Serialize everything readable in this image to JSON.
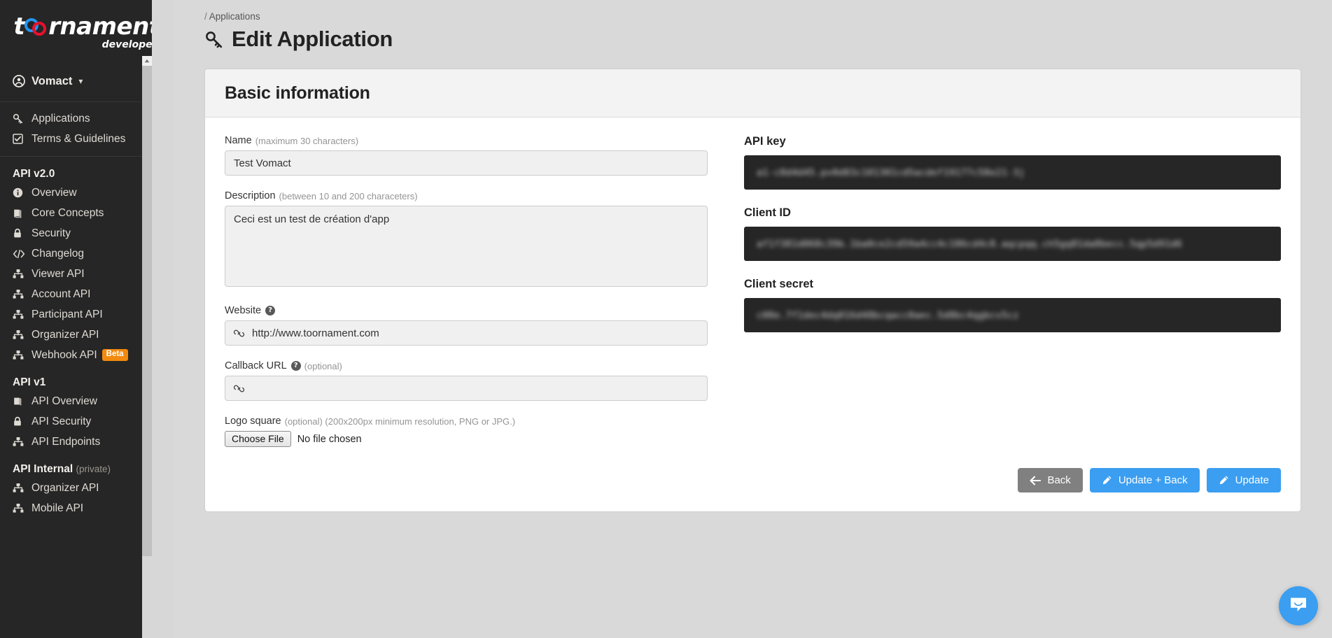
{
  "sidebar": {
    "logo": {
      "text_main": "t",
      "text_rest": "rnament",
      "subtitle": "developer"
    },
    "user": {
      "name": "Vomact",
      "avatar_icon": "user-circle-icon",
      "chevron_icon": "chevron-down-icon"
    },
    "primary_items": [
      {
        "label": "Applications",
        "icon": "key-icon"
      },
      {
        "label": "Terms & Guidelines",
        "icon": "checkbox-checked-icon"
      }
    ],
    "groups": [
      {
        "heading": "API v2.0",
        "heading_note": "",
        "items": [
          {
            "label": "Overview",
            "icon": "info-circle-icon"
          },
          {
            "label": "Core Concepts",
            "icon": "book-icon"
          },
          {
            "label": "Security",
            "icon": "lock-icon"
          },
          {
            "label": "Changelog",
            "icon": "code-icon"
          },
          {
            "label": "Viewer API",
            "icon": "sitemap-icon"
          },
          {
            "label": "Account API",
            "icon": "sitemap-icon"
          },
          {
            "label": "Participant API",
            "icon": "sitemap-icon"
          },
          {
            "label": "Organizer API",
            "icon": "sitemap-icon"
          },
          {
            "label": "Webhook API",
            "icon": "sitemap-icon",
            "badge": "Beta"
          }
        ]
      },
      {
        "heading": "API v1",
        "heading_note": "",
        "items": [
          {
            "label": "API Overview",
            "icon": "book-icon"
          },
          {
            "label": "API Security",
            "icon": "lock-icon"
          },
          {
            "label": "API Endpoints",
            "icon": "sitemap-icon"
          }
        ]
      },
      {
        "heading": "API Internal",
        "heading_note": "(private)",
        "items": [
          {
            "label": "Organizer API",
            "icon": "sitemap-icon"
          },
          {
            "label": "Mobile API",
            "icon": "sitemap-icon"
          }
        ]
      }
    ],
    "scrollbar": {
      "up_arrow_icon": "caret-up-icon"
    }
  },
  "header": {
    "breadcrumb_separator": "/",
    "breadcrumb_item": "Applications",
    "title": "Edit Application",
    "title_icon": "key-icon"
  },
  "card": {
    "heading": "Basic information",
    "fields": {
      "name": {
        "label": "Name",
        "hint": "(maximum 30 characters)",
        "value": "Test Vomact",
        "placeholder": ""
      },
      "description": {
        "label": "Description",
        "hint": "(between 10 and 200 characeters)",
        "value": "Ceci est un test de création d'app",
        "placeholder": ""
      },
      "website": {
        "label": "Website",
        "hint": "",
        "help_icon": "question-circle-icon",
        "prefix_icon": "link-icon",
        "value": "http://www.toornament.com",
        "placeholder": ""
      },
      "callback_url": {
        "label": "Callback URL",
        "hint": "(optional)",
        "help_icon": "question-circle-icon",
        "prefix_icon": "link-icon",
        "value": "",
        "placeholder": ""
      },
      "logo_square": {
        "label": "Logo square",
        "hint": "(optional) (200x200px minimum resolution, PNG or JPG.)",
        "button_label": "Choose File",
        "file_status": "No file chosen"
      }
    },
    "credentials": [
      {
        "label": "API key",
        "value": "a1-c8d4d45.pv0d83c101301cd5acdef19177c58e21-3j"
      },
      {
        "label": "Client ID",
        "value": "af1f381d068c39b.1ba0ce2cd59a4cc4c186cd4c8.aqcpqq.ch5gq81da8becc.5qp5d91d6"
      },
      {
        "label": "Client secret",
        "value": "c08e.7f1dec4dq016d48bcqacc0aec.5d8bc4qgbcv5cz"
      }
    ],
    "buttons": [
      {
        "label": "Back",
        "style": "grey",
        "icon": "arrow-left-icon"
      },
      {
        "label": "Update + Back",
        "style": "blue",
        "icon": "pencil-icon"
      },
      {
        "label": "Update",
        "style": "blue",
        "icon": "pencil-icon"
      }
    ]
  },
  "chat": {
    "icon": "chat-bubble-icon"
  },
  "colors": {
    "sidebar_bg": "#262626",
    "accent_blue": "#3b9ef0",
    "beta_orange": "#f28a0f",
    "logo_blue": "#2196f3",
    "logo_red": "#e8112d",
    "grey_button": "#808080",
    "page_bg": "#d9d9d9"
  }
}
